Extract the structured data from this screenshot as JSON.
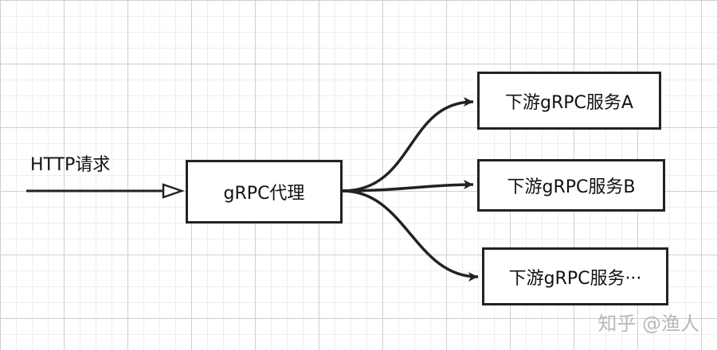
{
  "diagram": {
    "input_label": "HTTP请求",
    "proxy_label": "gRPC代理",
    "downstreams": [
      {
        "label": "下游gRPC服务A"
      },
      {
        "label": "下游gRPC服务B"
      },
      {
        "label": "下游gRPC服务···"
      }
    ]
  },
  "watermark": "知乎 @渔人",
  "colors": {
    "stroke": "#222222",
    "grid_major": "#cfcfcf",
    "grid_minor": "#eeeeee",
    "watermark": "#b8b8b8"
  }
}
